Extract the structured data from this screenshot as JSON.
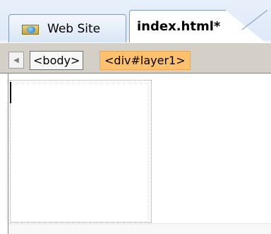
{
  "tabs": {
    "website_label": "Web Site",
    "website_icon": "website-folder-icon",
    "document_label": "index.html*"
  },
  "tag_selector": {
    "scroll_icon": "scroll-left-icon",
    "tags": [
      "<body>",
      "<div#layer1>"
    ],
    "selected_tag": "<div#layer1>",
    "selected_color": "#ffc16e"
  }
}
